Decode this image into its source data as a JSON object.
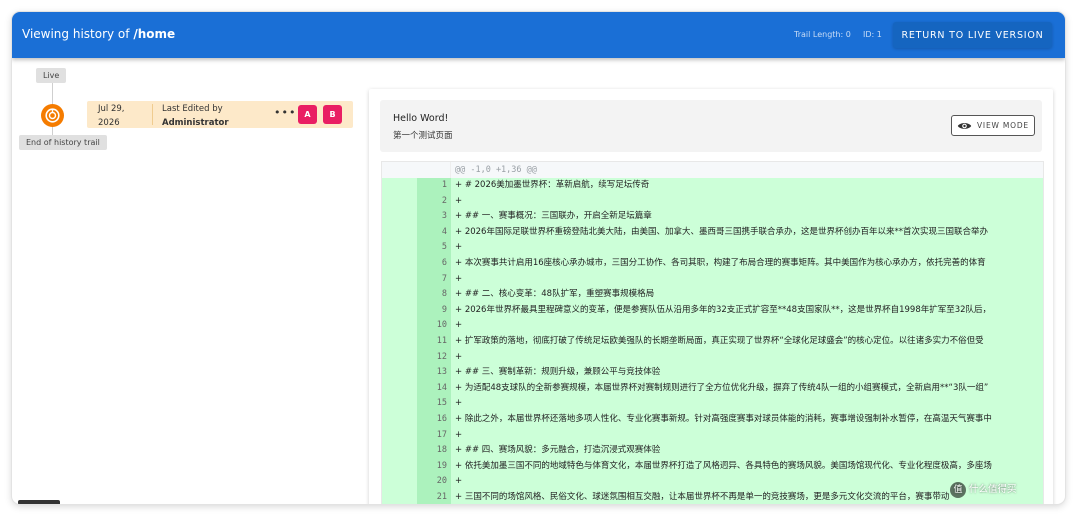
{
  "appbar": {
    "title_prefix": "Viewing history of ",
    "title_path": "/home",
    "trail_length": "Trail Length: 0",
    "id": "ID: 1",
    "return_label": "RETURN TO LIVE VERSION"
  },
  "trail": {
    "live_label": "Live",
    "end_label": "End of history trail",
    "entry": {
      "date_line1": "Jul 29,",
      "date_line2": "2026",
      "edited_label": "Last Edited by",
      "editor": "Administrator",
      "more": "•••",
      "btn_a": "A",
      "btn_b": "B"
    }
  },
  "preview": {
    "heading": "Hello Word!",
    "subtitle": "第一个测试页面",
    "view_mode_label": "VIEW MODE"
  },
  "diff": {
    "hunk": "@@ -1,0 +1,36 @@",
    "lines": [
      {
        "n": "1",
        "text": "+ # 2026美加墨世界杯：革新启航，续写足坛传奇"
      },
      {
        "n": "2",
        "text": "+"
      },
      {
        "n": "3",
        "text": "+ ## 一、赛事概况：三国联办，开启全新足坛篇章"
      },
      {
        "n": "4",
        "text": "+ 2026年国际足联世界杯重磅登陆北美大陆，由美国、加拿大、墨西哥三国携手联合承办，这是世界杯创办百年以来**首次实现三国联合举办"
      },
      {
        "n": "5",
        "text": "+"
      },
      {
        "n": "6",
        "text": "+ 本次赛事共计启用16座核心承办城市，三国分工协作、各司其职，构建了布局合理的赛事矩阵。其中美国作为核心承办方，依托完善的体育"
      },
      {
        "n": "7",
        "text": "+"
      },
      {
        "n": "8",
        "text": "+ ## 二、核心变革：48队扩军，重塑赛事规模格局"
      },
      {
        "n": "9",
        "text": "+ 2026年世界杯最具里程碑意义的变革，便是参赛队伍从沿用多年的32支正式扩容至**48支国家队**，这是世界杯自1998年扩军至32队后，"
      },
      {
        "n": "10",
        "text": "+"
      },
      {
        "n": "11",
        "text": "+ 扩军政策的落地，彻底打破了传统足坛欧美强队的长期垄断局面，真正实现了世界杯“全球化足球盛会”的核心定位。以往诸多实力不俗但受"
      },
      {
        "n": "12",
        "text": "+"
      },
      {
        "n": "13",
        "text": "+ ## 三、赛制革新：规则升级，兼顾公平与竞技体验"
      },
      {
        "n": "14",
        "text": "+ 为适配48支球队的全新参赛规模，本届世界杯对赛制规则进行了全方位优化升级，摒弃了传统4队一组的小组赛模式，全新启用**“3队一组”"
      },
      {
        "n": "15",
        "text": "+"
      },
      {
        "n": "16",
        "text": "+ 除此之外，本届世界杯还落地多项人性化、专业化赛事新规。针对高强度赛事对球员体能的消耗，赛事增设强制补水暂停，在高温天气赛事中"
      },
      {
        "n": "17",
        "text": "+"
      },
      {
        "n": "18",
        "text": "+ ## 四、赛场风貌：多元融合，打造沉浸式观赛体验"
      },
      {
        "n": "19",
        "text": "+ 依托美加墨三国不同的地域特色与体育文化，本届世界杯打造了风格迥异、各具特色的赛场风貌。美国场馆现代化、专业化程度极高，多座场"
      },
      {
        "n": "20",
        "text": "+"
      },
      {
        "n": "21",
        "text": "+ 三国不同的场馆风格、民俗文化、球迷氛围相互交融，让本届世界杯不再是单一的竞技赛场，更是多元文化交流的平台，赛事带动"
      }
    ]
  },
  "watermark": {
    "badge": "值",
    "text": "什么值得买"
  },
  "colors": {
    "appbar": "#1a6fd6",
    "return_button": "#1565c0",
    "trail_node": "#f57c00",
    "entry_bg": "#fde9c9",
    "pink_button": "#e91e63",
    "diff_added": "#ccffd8",
    "diff_added_gutter": "#acf2bd"
  },
  "icons": {
    "trail_node": "history-node-icon",
    "view_mode": "eye-icon"
  }
}
